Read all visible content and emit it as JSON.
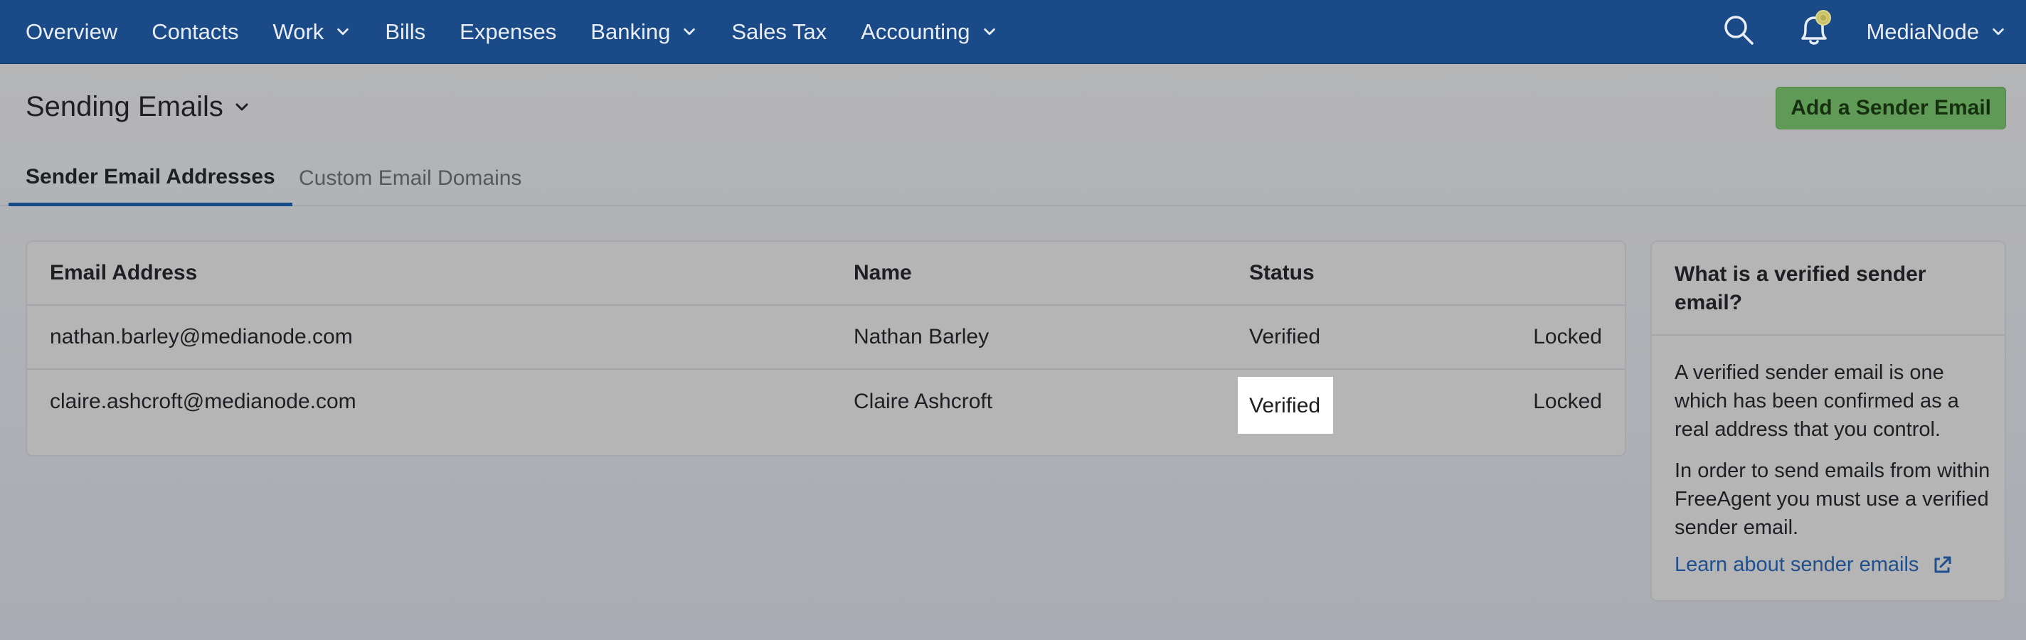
{
  "nav": {
    "items": [
      {
        "label": "Overview",
        "has_dropdown": false
      },
      {
        "label": "Contacts",
        "has_dropdown": false
      },
      {
        "label": "Work",
        "has_dropdown": true
      },
      {
        "label": "Bills",
        "has_dropdown": false
      },
      {
        "label": "Expenses",
        "has_dropdown": false
      },
      {
        "label": "Banking",
        "has_dropdown": true
      },
      {
        "label": "Sales Tax",
        "has_dropdown": false
      },
      {
        "label": "Accounting",
        "has_dropdown": true
      }
    ],
    "account_label": "MediaNode",
    "icons": [
      "search-icon",
      "notification-bell-icon"
    ]
  },
  "header": {
    "title": "Sending Emails",
    "add_button_label": "Add a Sender Email"
  },
  "tabs": [
    {
      "label": "Sender Email Addresses",
      "active": true
    },
    {
      "label": "Custom Email Domains",
      "active": false
    }
  ],
  "table": {
    "columns": [
      "Email Address",
      "Name",
      "Status"
    ],
    "rows": [
      {
        "email": "nathan.barley@medianode.com",
        "name": "Nathan Barley",
        "status": "Verified",
        "lock": "Locked"
      },
      {
        "email": "claire.ashcroft@medianode.com",
        "name": "Claire Ashcroft",
        "status": "Verified",
        "lock": "Locked"
      }
    ]
  },
  "help": {
    "title": "What is a verified sender email?",
    "paragraph1": "A verified sender email is one which has been confirmed as a real address that you control.",
    "paragraph2": "In order to send emails from within FreeAgent you must use a verified sender email.",
    "link_label": "Learn about sender emails"
  },
  "colors": {
    "nav_bg": "#1b4a88",
    "primary_button": "#5f9a56",
    "link": "#1f4f8f",
    "active_tab_underline": "#1b4a88"
  }
}
